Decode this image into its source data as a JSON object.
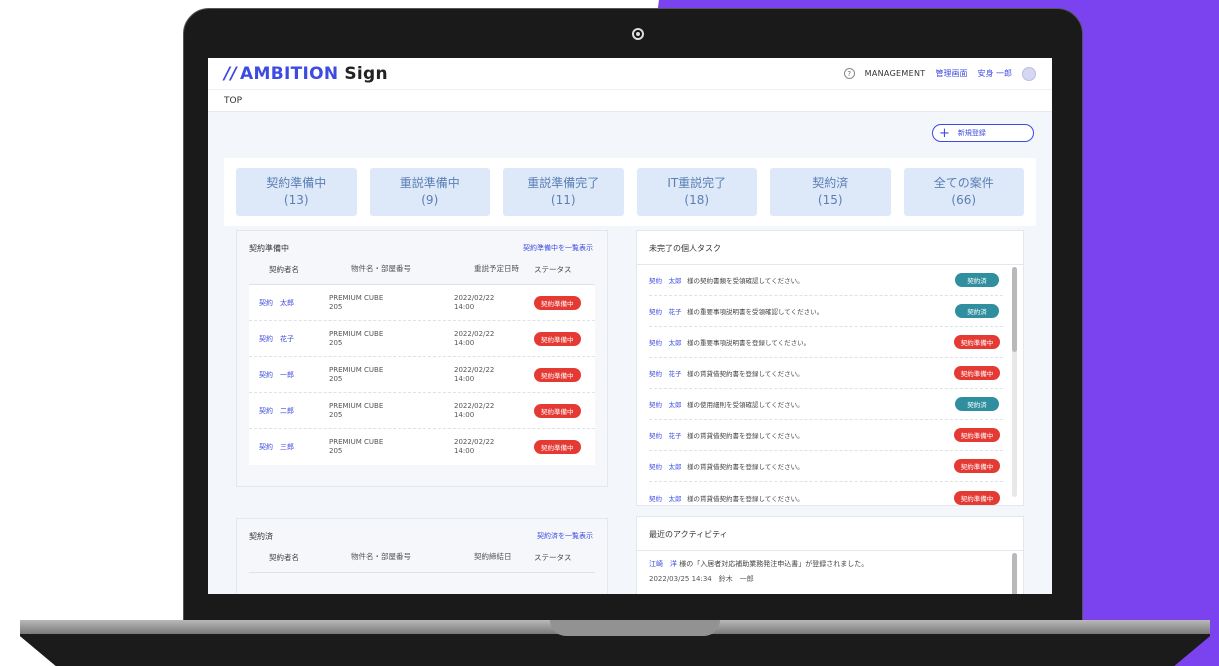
{
  "logo": {
    "mark": "//",
    "ambition": "AMBITION",
    "sign": "Sign"
  },
  "header": {
    "help_icon": "?",
    "management": "MANAGEMENT",
    "admin": "管理画面",
    "user": "安身 一郎"
  },
  "breadcrumb": "TOP",
  "new_button": {
    "icon": "+",
    "label": "新規登録"
  },
  "stats": [
    {
      "label": "契約準備中",
      "count": "(13)"
    },
    {
      "label": "重説準備中",
      "count": "(9)"
    },
    {
      "label": "重説準備完了",
      "count": "(11)"
    },
    {
      "label": "IT重説完了",
      "count": "(18)"
    },
    {
      "label": "契約済",
      "count": "(15)"
    },
    {
      "label": "全ての案件",
      "count": "(66)"
    }
  ],
  "prep": {
    "title": "契約準備中",
    "link": "契約準備中を一覧表示",
    "headers": [
      "契約者名",
      "物件名・部屋番号",
      "重説予定日時",
      "ステータス"
    ],
    "rows": [
      {
        "name": "契約　太郎",
        "prop1": "PREMIUM CUBE",
        "prop2": "205",
        "date": "2022/02/22",
        "time": "14:00",
        "status": "契約準備中"
      },
      {
        "name": "契約　花子",
        "prop1": "PREMIUM CUBE",
        "prop2": "205",
        "date": "2022/02/22",
        "time": "14:00",
        "status": "契約準備中"
      },
      {
        "name": "契約　一郎",
        "prop1": "PREMIUM CUBE",
        "prop2": "205",
        "date": "2022/02/22",
        "time": "14:00",
        "status": "契約準備中"
      },
      {
        "name": "契約　二郎",
        "prop1": "PREMIUM CUBE",
        "prop2": "205",
        "date": "2022/02/22",
        "time": "14:00",
        "status": "契約準備中"
      },
      {
        "name": "契約　三郎",
        "prop1": "PREMIUM CUBE",
        "prop2": "205",
        "date": "2022/02/22",
        "time": "14:00",
        "status": "契約準備中"
      }
    ]
  },
  "done": {
    "title": "契約済",
    "link": "契約済を一覧表示",
    "headers": [
      "契約者名",
      "物件名・部屋番号",
      "契約締結日",
      "ステータス"
    ]
  },
  "tasks": {
    "title": "未完了の個人タスク",
    "items": [
      {
        "name": "契約　太郎",
        "text": "様の契約書類を受領確認してください。",
        "status": "契約済",
        "type": "teal"
      },
      {
        "name": "契約　花子",
        "text": "様の重要事項説明書を受領確認してください。",
        "status": "契約済",
        "type": "teal"
      },
      {
        "name": "契約　太郎",
        "text": "様の重要事項説明書を登録してください。",
        "status": "契約準備中",
        "type": "red"
      },
      {
        "name": "契約　花子",
        "text": "様の賃貸借契約書を登録してください。",
        "status": "契約準備中",
        "type": "red"
      },
      {
        "name": "契約　太郎",
        "text": "様の使用細則を受領確認してください。",
        "status": "契約済",
        "type": "teal"
      },
      {
        "name": "契約　花子",
        "text": "様の賃貸借契約書を登録してください。",
        "status": "契約準備中",
        "type": "red"
      },
      {
        "name": "契約　太郎",
        "text": "様の賃貸借契約書を登録してください。",
        "status": "契約準備中",
        "type": "red"
      },
      {
        "name": "契約　太郎",
        "text": "様の賃貸借契約書を登録してください。",
        "status": "契約準備中",
        "type": "red"
      }
    ]
  },
  "activity": {
    "title": "最近のアクティビティ",
    "items": [
      {
        "name": "江崎　洋",
        "text": "様の「入居者対応補助業務発注申込書」が登録されました。",
        "meta": "2022/03/25 14:34　鈴木　一郎"
      }
    ]
  },
  "colors": {
    "accent": "#3d4be0",
    "purple": "#7b43f0",
    "red": "#e53a34",
    "teal": "#2f8f9e",
    "stat_bg": "#dde9f8"
  }
}
